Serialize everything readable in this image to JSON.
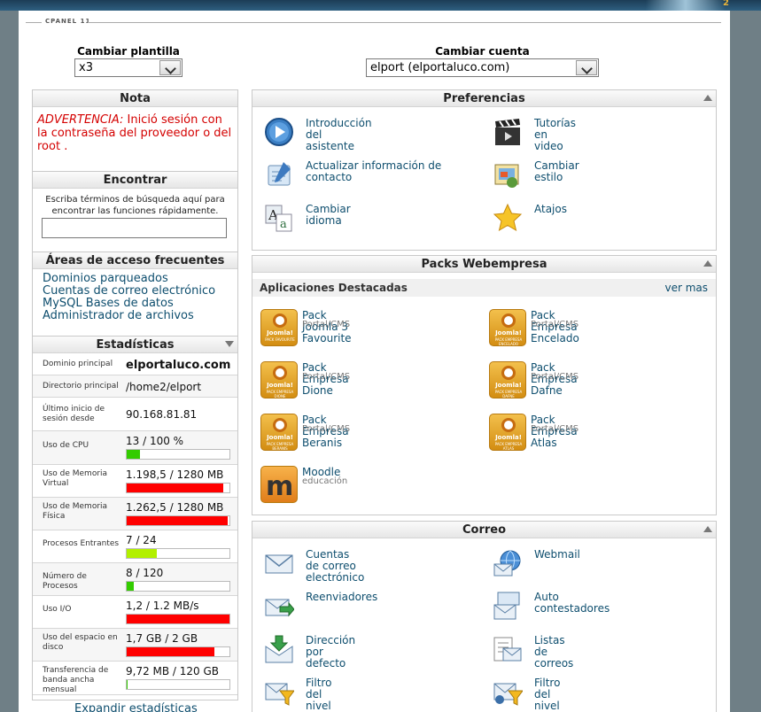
{
  "header": {
    "version_tag": "CPANEL 11",
    "brand_digit": "2"
  },
  "selectors": {
    "template": {
      "label": "Cambiar plantilla",
      "value": "x3"
    },
    "account": {
      "label": "Cambiar cuenta",
      "value": "elport (elportaluco.com)"
    }
  },
  "nota": {
    "title": "Nota",
    "warning_prefix": "ADVERTENCIA:",
    "warning_text": " Inició sesión con la contraseña del proveedor o del root ."
  },
  "find": {
    "title": "Encontrar",
    "hint": "Escriba términos de búsqueda aquí para encontrar las funciones rápidamente.",
    "value": ""
  },
  "frequent": {
    "title": "Áreas de acceso frecuentes",
    "links": [
      "Dominios parqueados",
      "Cuentas de correo electrónico",
      "MySQL Bases de datos",
      "Administrador de archivos"
    ]
  },
  "stats": {
    "title": "Estadísticas",
    "rows": [
      {
        "label": "Dominio principal",
        "value": "elportaluco.com"
      },
      {
        "label": "Directorio principal",
        "value": "/home2/elport"
      },
      {
        "label": "Último inicio de sesión desde",
        "value": "90.168.81.81"
      },
      {
        "label": "Uso de CPU",
        "value": "13 / 100 %",
        "fraction": 0.13,
        "color": "#33cc00"
      },
      {
        "label": "Uso de Memoria Virtual",
        "value": "1.198,5 / 1280 MB",
        "fraction": 0.936,
        "color": "#ff0000"
      },
      {
        "label": "Uso de Memoria Física",
        "value": "1.262,5 / 1280 MB",
        "fraction": 0.986,
        "color": "#ff0000"
      },
      {
        "label": "Procesos Entrantes",
        "value": "7 / 24",
        "fraction": 0.29,
        "color": "#b2f000"
      },
      {
        "label": "Número de Procesos",
        "value": "8 / 120",
        "fraction": 0.067,
        "color": "#33cc00"
      },
      {
        "label": "Uso I/O",
        "value": "1,2 / 1.2 MB/s",
        "fraction": 1.0,
        "color": "#ff0000"
      },
      {
        "label": "Uso del espacio en disco",
        "value": "1,7 GB / 2 GB",
        "fraction": 0.85,
        "color": "#ff0000"
      },
      {
        "label": "Transferencia de banda ancha mensual",
        "value": "9,72 MB / 120 GB",
        "fraction": 0.001,
        "color": "#33cc00"
      }
    ],
    "expand": "Expandir estadísticas"
  },
  "preferencias": {
    "title": "Preferencias",
    "items": [
      {
        "label": "Introducción del asistente",
        "icon": "play-circle-icon"
      },
      {
        "label": "Tutorías en video",
        "icon": "video-clapper-icon"
      },
      {
        "label": "Actualizar información de contacto",
        "icon": "contact-update-icon"
      },
      {
        "label": "Cambiar estilo",
        "icon": "style-palette-icon"
      },
      {
        "label": "Cambiar idioma",
        "icon": "language-icon"
      },
      {
        "label": "Atajos",
        "icon": "star-icon"
      }
    ]
  },
  "packs": {
    "title": "Packs Webempresa",
    "subheader": "Aplicaciones Destacadas",
    "more": "ver mas",
    "joomla_text": "Joomla!",
    "items": [
      {
        "label": "Pack Joomla 3 Favourite",
        "sub": "Portal/CMS",
        "badge": "PACK FAVOURITE"
      },
      {
        "label": "Pack Empresa Encelado",
        "sub": "Portal/CMS",
        "badge": "PACK EMPRESA ENCELADO"
      },
      {
        "label": "Pack Empresa Dione",
        "sub": "Portal/CMS",
        "badge": "PACK EMPRESA DIONE"
      },
      {
        "label": "Pack Empresa Dafne",
        "sub": "Portal/CMS",
        "badge": "PACK EMPRESA DAFNE"
      },
      {
        "label": "Pack Empresa Beranis",
        "sub": "Portal/CMS",
        "badge": "PACK EMPRESA BERANIS"
      },
      {
        "label": "Pack Empresa Atlas",
        "sub": "Portal/CMS",
        "badge": "PACK EMPRESA ATLAS"
      },
      {
        "label": "Moodle",
        "sub": "educación",
        "letter": "m"
      }
    ]
  },
  "correo": {
    "title": "Correo",
    "items": [
      {
        "label": "Cuentas de correo electrónico",
        "icon": "envelope-icon"
      },
      {
        "label": "Webmail",
        "icon": "webmail-globe-icon"
      },
      {
        "label": "Reenviadores",
        "icon": "forward-mail-icon"
      },
      {
        "label": "Auto contestadores",
        "icon": "auto-responder-icon"
      },
      {
        "label": "Dirección por defecto",
        "icon": "default-address-icon"
      },
      {
        "label": "Listas de correos",
        "icon": "mailing-list-icon"
      },
      {
        "label": "Filtro del nivel de cuenta",
        "icon": "account-filter-icon"
      },
      {
        "label": "Filtro del nivel de usuario",
        "icon": "user-filter-icon"
      }
    ]
  }
}
